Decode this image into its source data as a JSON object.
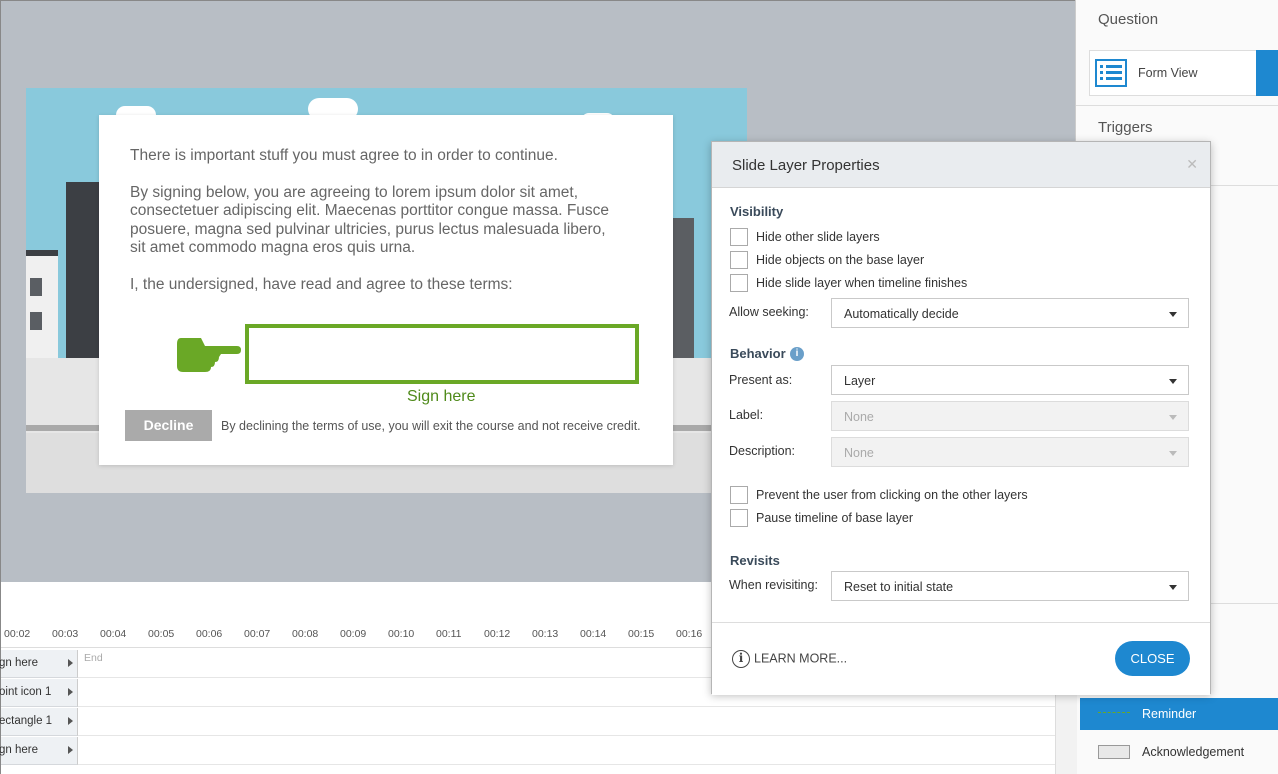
{
  "slide": {
    "paragraph1": "There is important stuff you must agree to in order to continue.",
    "paragraph2_lines": [
      "By signing below, you are agreeing to lorem ipsum dolor sit amet,",
      "consectetuer adipiscing elit. Maecenas porttitor congue massa. Fusce",
      "posuere, magna sed pulvinar ultricies, purus lectus malesuada libero,",
      "sit amet commodo magna eros quis urna."
    ],
    "paragraph3": "I, the undersigned, have read and agree to these terms:",
    "sign_label": "Sign here",
    "decline_button": "Decline",
    "decline_note": "By declining the terms of use, you will exit the course and not receive credit.",
    "accent_color": "#6aa826"
  },
  "right_panel": {
    "question_header": "Question",
    "form_view_label": "Form View",
    "triggers_header": "Triggers",
    "layers": [
      {
        "name": "Reminder",
        "active": true
      },
      {
        "name": "Acknowledgement",
        "active": false
      }
    ]
  },
  "timeline": {
    "ticks": [
      "00:02",
      "00:03",
      "00:04",
      "00:05",
      "00:06",
      "00:07",
      "00:08",
      "00:09",
      "00:10",
      "00:11",
      "00:12",
      "00:13",
      "00:14",
      "00:15",
      "00:16"
    ],
    "end_label": "End",
    "tracks": [
      "gn here",
      "oint icon 1",
      "ectangle 1",
      "gn here"
    ]
  },
  "dialog": {
    "title": "Slide Layer Properties",
    "visibility_header": "Visibility",
    "hide_other": "Hide other slide layers",
    "hide_base": "Hide objects on the base layer",
    "hide_when_finish": "Hide slide layer when timeline finishes",
    "allow_seeking_label": "Allow seeking:",
    "allow_seeking_value": "Automatically decide",
    "behavior_header": "Behavior",
    "present_as_label": "Present as:",
    "present_as_value": "Layer",
    "label_label": "Label:",
    "label_value": "None",
    "description_label": "Description:",
    "description_value": "None",
    "prevent_clicking": "Prevent the user from clicking on the other layers",
    "pause_timeline": "Pause timeline of base layer",
    "revisits_header": "Revisits",
    "when_revisiting_label": "When revisiting:",
    "when_revisiting_value": "Reset to initial state",
    "learn_more": "LEARN MORE...",
    "close_button": "CLOSE",
    "accent_color": "#1e88d0"
  }
}
